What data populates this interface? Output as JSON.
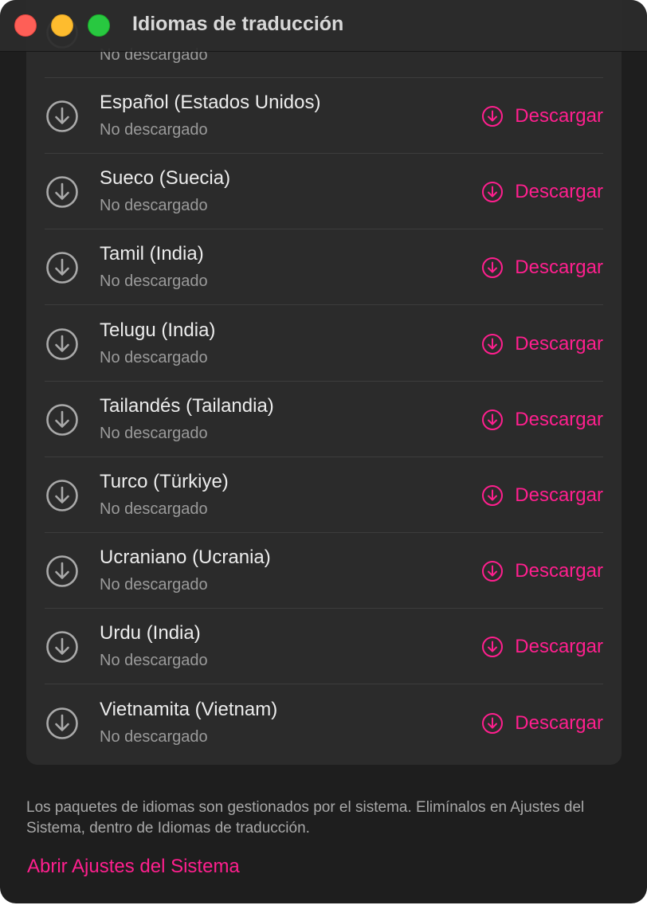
{
  "window": {
    "title": "Idiomas de traducción",
    "accent_color": "#ff1f8e"
  },
  "list": {
    "partial_row_status": "No descargado",
    "items": [
      {
        "name": "Español (Estados Unidos)",
        "status": "No descargado",
        "action": "Descargar",
        "icon": "download-circle-icon"
      },
      {
        "name": "Sueco (Suecia)",
        "status": "No descargado",
        "action": "Descargar",
        "icon": "download-circle-icon"
      },
      {
        "name": "Tamil (India)",
        "status": "No descargado",
        "action": "Descargar",
        "icon": "download-circle-icon"
      },
      {
        "name": "Telugu (India)",
        "status": "No descargado",
        "action": "Descargar",
        "icon": "download-circle-icon"
      },
      {
        "name": "Tailandés (Tailandia)",
        "status": "No descargado",
        "action": "Descargar",
        "icon": "download-circle-icon"
      },
      {
        "name": "Turco (Türkiye)",
        "status": "No descargado",
        "action": "Descargar",
        "icon": "download-circle-icon"
      },
      {
        "name": "Ucraniano (Ucrania)",
        "status": "No descargado",
        "action": "Descargar",
        "icon": "download-circle-icon"
      },
      {
        "name": "Urdu (India)",
        "status": "No descargado",
        "action": "Descargar",
        "icon": "download-circle-icon"
      },
      {
        "name": "Vietnamita (Vietnam)",
        "status": "No descargado",
        "action": "Descargar",
        "icon": "download-circle-icon"
      }
    ]
  },
  "footer": {
    "note": "Los paquetes de idiomas son gestionados por el sistema. Elimínalos en Ajustes del Sistema, dentro de Idiomas de traducción.",
    "link": "Abrir Ajustes del Sistema"
  }
}
